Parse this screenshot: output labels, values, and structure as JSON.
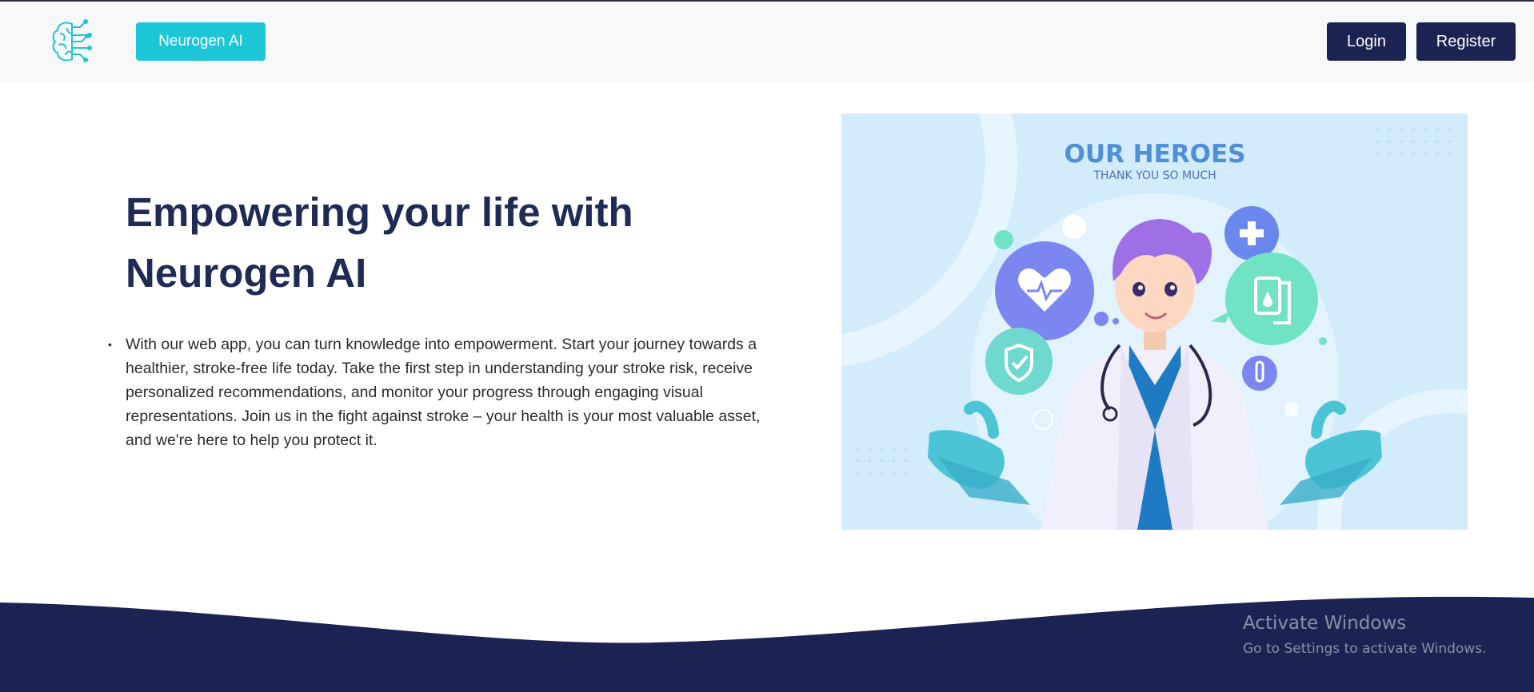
{
  "header": {
    "brand_label": "Neurogen AI",
    "login_label": "Login",
    "register_label": "Register",
    "logo_icon": "brain-circuit-icon"
  },
  "hero": {
    "title_line1": "Empowering your life with",
    "title_line2": "Neurogen AI",
    "description": "With our web app, you can turn knowledge into empowerment. Start your journey towards a healthier, stroke-free life today. Take the first step in understanding your stroke risk, receive personalized recommendations, and monitor your progress through engaging visual representations. Join us in the fight against stroke – your health is your most valuable asset, and we're here to help you protect it."
  },
  "illustration": {
    "heading": "OUR HEROES",
    "subheading": "THANK YOU SO MUCH"
  },
  "watermark": {
    "title": "Activate Windows",
    "subtitle": "Go to Settings to activate Windows."
  },
  "colors": {
    "brand": "#1cc6d7",
    "navy": "#1b2352",
    "title": "#1f2a55",
    "illustration_bg": "#d3ecfb"
  }
}
